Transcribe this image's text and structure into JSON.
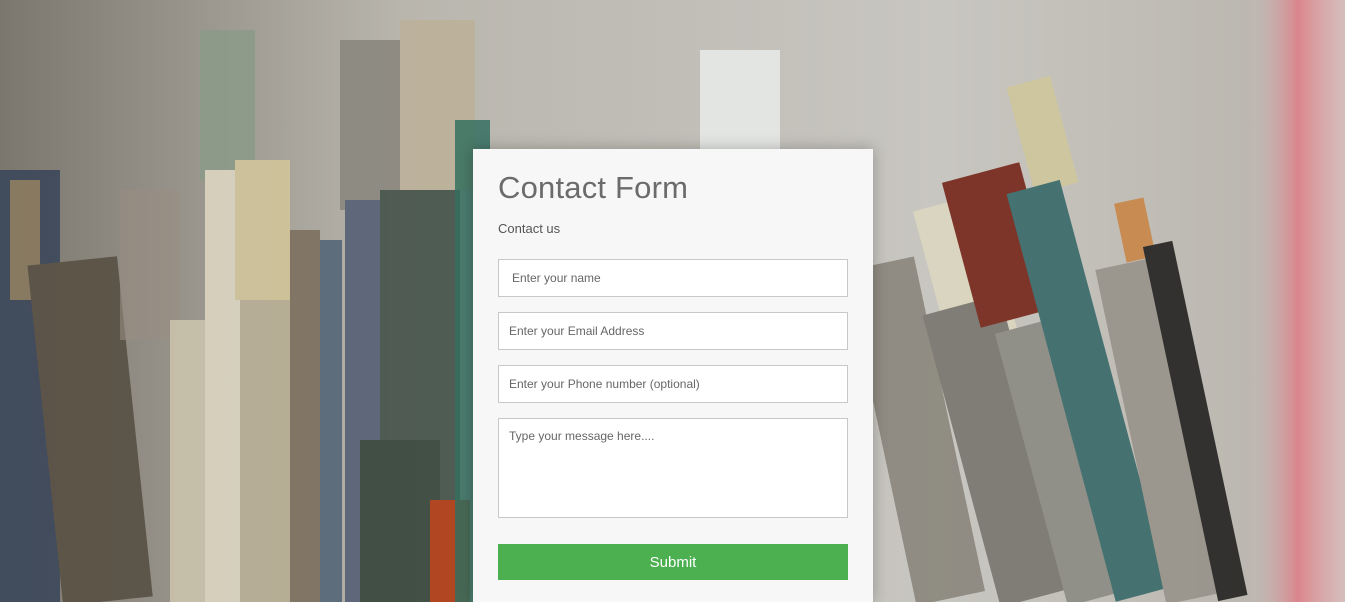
{
  "background": {
    "description_icon": "paint-brushes-photo",
    "tones": [
      "#8c8981",
      "#bdbab3"
    ]
  },
  "form": {
    "title": "Contact Form",
    "subtitle": "Contact us",
    "name_placeholder": "Enter your name",
    "email_placeholder": "Enter your Email Address",
    "phone_placeholder": "Enter your Phone number (optional)",
    "message_placeholder": "Type your message here....",
    "submit_label": "Submit",
    "accent_color": "#4caf50"
  }
}
